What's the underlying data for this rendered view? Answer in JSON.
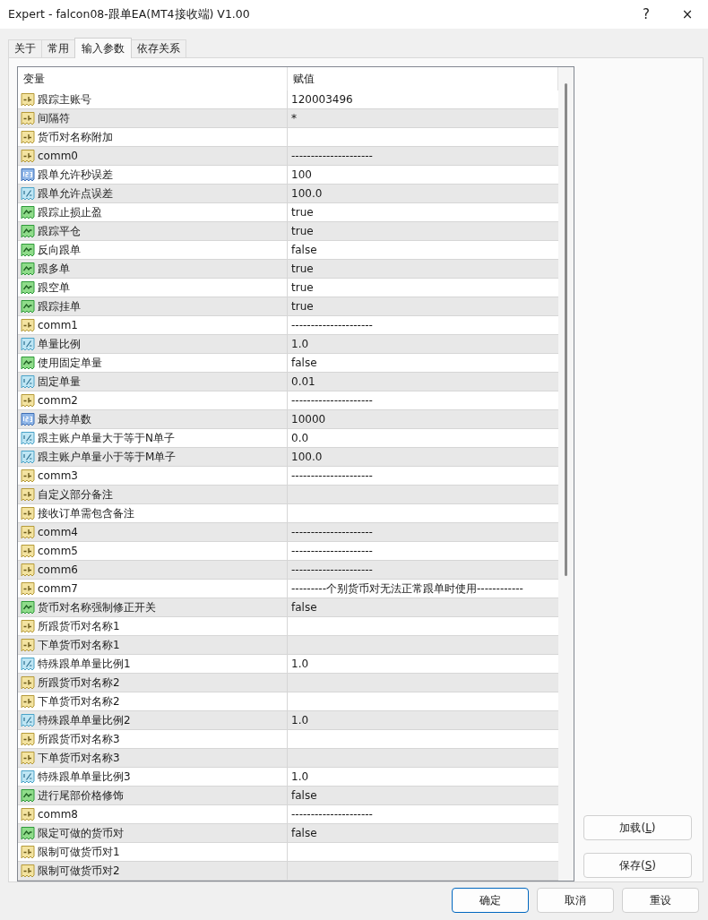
{
  "window": {
    "title": "Expert - falcon08-跟单EA(MT4接收端) V1.00",
    "help_button": "?",
    "close_button": "×"
  },
  "tabs": [
    {
      "label": "关于",
      "selected": false
    },
    {
      "label": "常用",
      "selected": false
    },
    {
      "label": "输入参数",
      "selected": true
    },
    {
      "label": "依存关系",
      "selected": false
    }
  ],
  "table": {
    "columns": [
      "变量",
      "赋值"
    ],
    "rows": [
      {
        "kind": "string",
        "name": "跟踪主账号",
        "value": "120003496"
      },
      {
        "kind": "string",
        "name": "间隔符",
        "value": "*"
      },
      {
        "kind": "string",
        "name": "货币对名称附加"
      },
      {
        "kind": "string",
        "name": "comm0",
        "value": "---------------------"
      },
      {
        "kind": "int",
        "name": "跟单允许秒误差",
        "value": "100"
      },
      {
        "kind": "double",
        "name": "跟单允许点误差",
        "value": "100.0"
      },
      {
        "kind": "bool",
        "name": "跟踪止损止盈",
        "value": "true"
      },
      {
        "kind": "bool",
        "name": "跟踪平仓",
        "value": "true"
      },
      {
        "kind": "bool",
        "name": "反向跟单",
        "value": "false"
      },
      {
        "kind": "bool",
        "name": "跟多单",
        "value": "true"
      },
      {
        "kind": "bool",
        "name": "跟空单",
        "value": "true"
      },
      {
        "kind": "bool",
        "name": "跟踪挂单",
        "value": "true"
      },
      {
        "kind": "string",
        "name": "comm1",
        "value": "---------------------"
      },
      {
        "kind": "double",
        "name": "单量比例",
        "value": "1.0"
      },
      {
        "kind": "bool",
        "name": "使用固定单量",
        "value": "false"
      },
      {
        "kind": "double",
        "name": "固定单量",
        "value": "0.01"
      },
      {
        "kind": "string",
        "name": "comm2",
        "value": "---------------------"
      },
      {
        "kind": "int",
        "name": "最大持单数",
        "value": "10000"
      },
      {
        "kind": "double",
        "name": "跟主账户单量大于等于N单子",
        "value": "0.0"
      },
      {
        "kind": "double",
        "name": "跟主账户单量小于等于M单子",
        "value": "100.0"
      },
      {
        "kind": "string",
        "name": "comm3",
        "value": "---------------------"
      },
      {
        "kind": "string",
        "name": "自定义部分备注"
      },
      {
        "kind": "string",
        "name": "接收订单需包含备注"
      },
      {
        "kind": "string",
        "name": "comm4",
        "value": "---------------------"
      },
      {
        "kind": "string",
        "name": "comm5",
        "value": "---------------------"
      },
      {
        "kind": "string",
        "name": "comm6",
        "value": "---------------------"
      },
      {
        "kind": "string",
        "name": "comm7",
        "value": "---------个别货币对无法正常跟单时使用------------"
      },
      {
        "kind": "bool",
        "name": "货币对名称强制修正开关",
        "value": "false"
      },
      {
        "kind": "string",
        "name": "所跟货币对名称1"
      },
      {
        "kind": "string",
        "name": "下单货币对名称1"
      },
      {
        "kind": "double",
        "name": "特殊跟单单量比例1",
        "value": "1.0"
      },
      {
        "kind": "string",
        "name": "所跟货币对名称2"
      },
      {
        "kind": "string",
        "name": "下单货币对名称2"
      },
      {
        "kind": "double",
        "name": "特殊跟单单量比例2",
        "value": "1.0"
      },
      {
        "kind": "string",
        "name": "所跟货币对名称3"
      },
      {
        "kind": "string",
        "name": "下单货币对名称3"
      },
      {
        "kind": "double",
        "name": "特殊跟单单量比例3",
        "value": "1.0"
      },
      {
        "kind": "bool",
        "name": "进行尾部价格修饰",
        "value": "false"
      },
      {
        "kind": "string",
        "name": "comm8",
        "value": "---------------------"
      },
      {
        "kind": "bool",
        "name": "限定可做的货币对",
        "value": "false"
      },
      {
        "kind": "string",
        "name": "限制可做货币对1"
      },
      {
        "kind": "string",
        "name": "限制可做货币对2"
      }
    ]
  },
  "side_buttons": [
    {
      "label": "加载(",
      "mnemonic": "L",
      "label_end": ")"
    },
    {
      "label": "保存(",
      "mnemonic": "S",
      "label_end": ")"
    }
  ],
  "dialog_buttons": [
    {
      "label": "确定",
      "default": true
    },
    {
      "label": "取消",
      "default": false
    },
    {
      "label": "重设",
      "default": false
    }
  ]
}
